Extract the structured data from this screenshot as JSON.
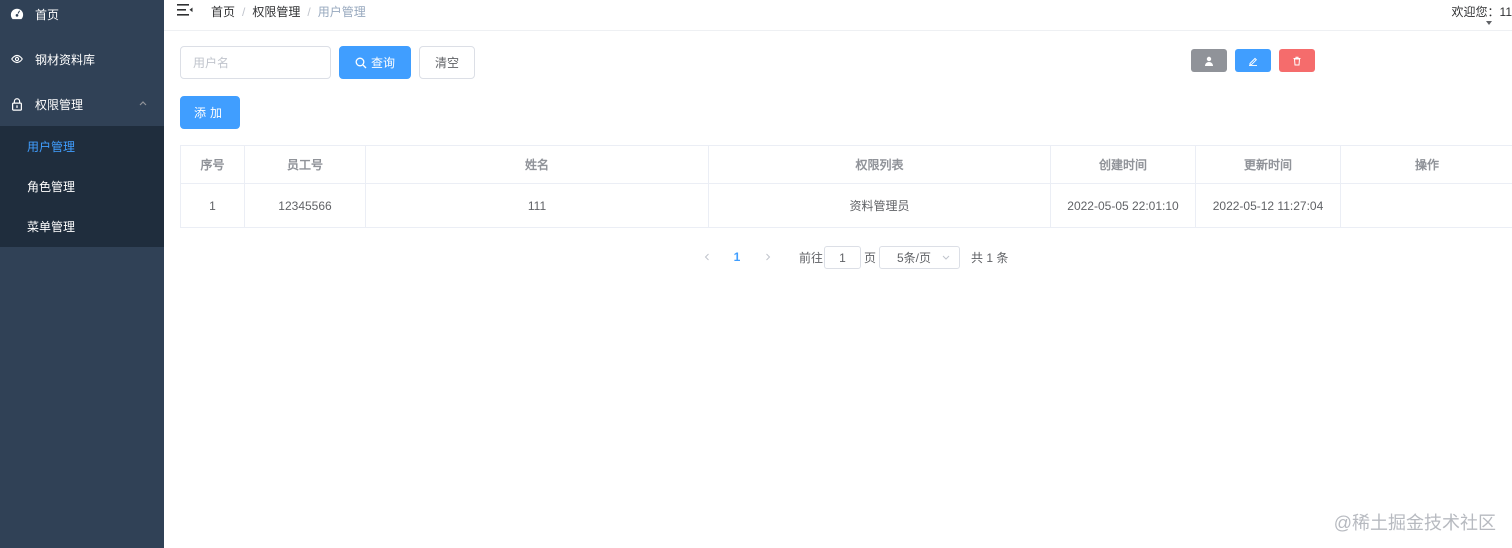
{
  "sidebar": {
    "items": [
      {
        "label": "首页",
        "icon": "dashboard-icon"
      },
      {
        "label": "钢材资料库",
        "icon": "eye-icon"
      },
      {
        "label": "权限管理",
        "icon": "lock-icon",
        "expanded": true
      }
    ],
    "submenu": [
      {
        "label": "用户管理",
        "active": true
      },
      {
        "label": "角色管理"
      },
      {
        "label": "菜单管理"
      }
    ],
    "colors": {
      "background": "#304156",
      "submenu_background": "#1f2d3d",
      "active": "#409eff"
    }
  },
  "header": {
    "breadcrumb": [
      "首页",
      "权限管理",
      "用户管理"
    ],
    "separator": "/",
    "welcome": "欢迎您：11"
  },
  "toolbar": {
    "username_placeholder": "用户名",
    "username_value": "",
    "search_label": "查询",
    "clear_label": "清空",
    "add_label": "添加"
  },
  "table": {
    "columns": [
      "序号",
      "员工号",
      "姓名",
      "权限列表",
      "创建时间",
      "更新时间",
      "操作"
    ],
    "rows": [
      {
        "index": "1",
        "employee_id": "12345566",
        "name": "111",
        "permissions": "资料管理员",
        "created": "2022-05-05 22:01:10",
        "updated": "2022-05-12 11:27:04"
      }
    ],
    "actions": [
      {
        "icon": "user-icon",
        "color": "#909399"
      },
      {
        "icon": "edit-icon",
        "color": "#409eff"
      },
      {
        "icon": "delete-icon",
        "color": "#f56c6c"
      }
    ]
  },
  "pagination": {
    "current_page": "1",
    "goto_label": "前往",
    "goto_value": "1",
    "page_label": "页",
    "page_size": "5条/页",
    "total": "共 1 条"
  },
  "watermark": "@稀土掘金技术社区",
  "colors": {
    "primary": "#409eff",
    "danger": "#f56c6c",
    "info": "#909399"
  }
}
